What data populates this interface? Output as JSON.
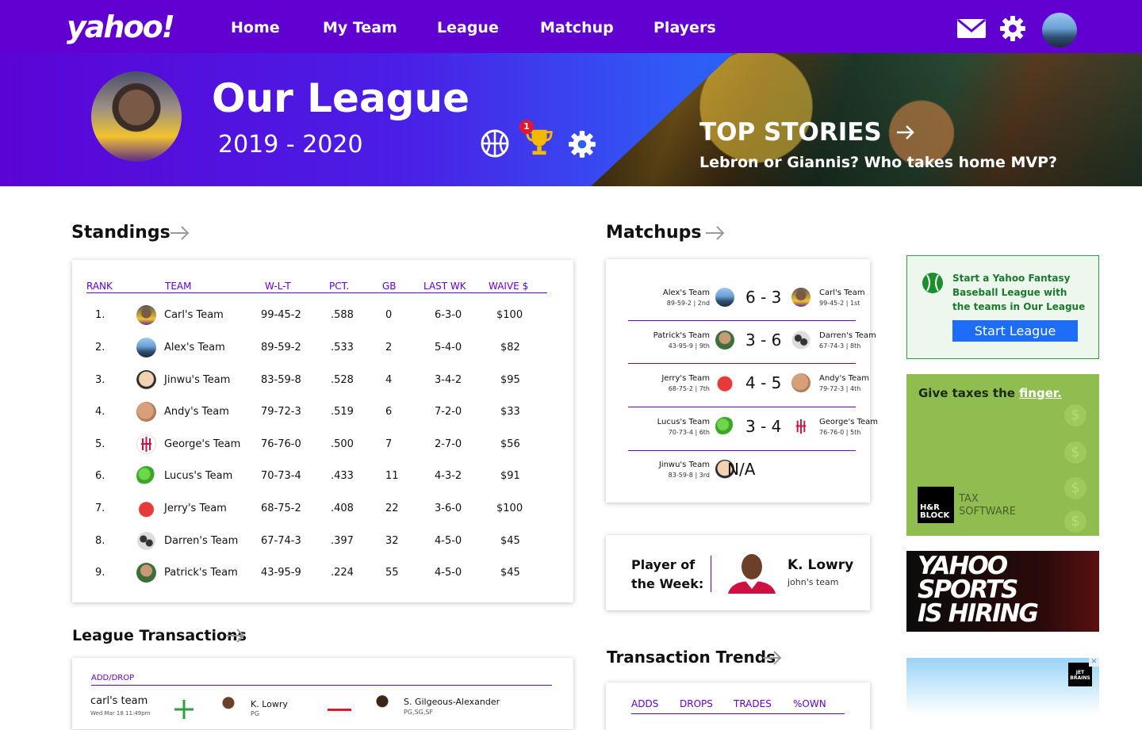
{
  "nav": {
    "logo": "yahoo!",
    "links": [
      "Home",
      "My Team",
      "League",
      "Matchup",
      "Players"
    ],
    "icons": [
      "mail-icon",
      "gear-icon"
    ]
  },
  "hero": {
    "title": "Our League",
    "season": "2019 - 2020",
    "notification_count": "1",
    "stories_title": "TOP STORIES",
    "stories_sub": "Lebron or Giannis? Who takes home MVP?"
  },
  "standings": {
    "title": "Standings",
    "headers": [
      "RANK",
      "TEAM",
      "W-L-T",
      "PCT.",
      "GB",
      "LAST WK",
      "WAIVE $"
    ],
    "rows": [
      {
        "rank": "1.",
        "team": "Carl's Team",
        "wlt": "99-45-2",
        "pct": ".588",
        "gb": "0",
        "last": "6-3-0",
        "waive": "$100"
      },
      {
        "rank": "2.",
        "team": "Alex's Team",
        "wlt": "89-59-2",
        "pct": ".533",
        "gb": "2",
        "last": "5-4-0",
        "waive": "$82"
      },
      {
        "rank": "3.",
        "team": "Jinwu's Team",
        "wlt": "83-59-8",
        "pct": ".528",
        "gb": "4",
        "last": "3-4-2",
        "waive": "$95"
      },
      {
        "rank": "4.",
        "team": "Andy's Team",
        "wlt": "79-72-3",
        "pct": ".519",
        "gb": "6",
        "last": "7-2-0",
        "waive": "$33"
      },
      {
        "rank": "5.",
        "team": "George's Team",
        "wlt": "76-76-0",
        "pct": ".500",
        "gb": "7",
        "last": "2-7-0",
        "waive": "$56"
      },
      {
        "rank": "6.",
        "team": "Lucus's Team",
        "wlt": "70-73-4",
        "pct": ".433",
        "gb": "11",
        "last": "4-3-2",
        "waive": "$91"
      },
      {
        "rank": "7.",
        "team": "Jerry's Team",
        "wlt": "68-75-2",
        "pct": ".408",
        "gb": "22",
        "last": "3-6-0",
        "waive": "$100"
      },
      {
        "rank": "8.",
        "team": "Darren's Team",
        "wlt": "67-74-3",
        "pct": ".397",
        "gb": "32",
        "last": "4-5-0",
        "waive": "$45"
      },
      {
        "rank": "9.",
        "team": "Patrick's Team",
        "wlt": "43-95-9",
        "pct": ".224",
        "gb": "55",
        "last": "4-5-0",
        "waive": "$45"
      }
    ]
  },
  "matchups": {
    "title": "Matchups",
    "rows": [
      {
        "left": "Alex's Team",
        "left_rec": "89-59-2  |  2nd",
        "score": "6 - 3",
        "right": "Carl's Team",
        "right_rec": "99-45-2  |  1st"
      },
      {
        "left": "Patrick's Team",
        "left_rec": "43-95-9  |  9th",
        "score": "3 - 6",
        "right": "Darren's Team",
        "right_rec": "67-74-3  |  8th"
      },
      {
        "left": "Jerry's Team",
        "left_rec": "68-75-2  |  7th",
        "score": "4 - 5",
        "right": "Andy's Team",
        "right_rec": "79-72-3  |  4th"
      },
      {
        "left": "Lucus's Team",
        "left_rec": "70-73-4  |  6th",
        "score": "3 - 4",
        "right": "George's Team",
        "right_rec": "76-76-0  |  5th"
      },
      {
        "left": "Jinwu's Team",
        "left_rec": "83-59-8  |  3rd",
        "score": "N/A",
        "right": "",
        "right_rec": ""
      }
    ]
  },
  "potw": {
    "label_line1": "Player of",
    "label_line2": "the Week:",
    "player": "K. Lowry",
    "team": "john's team"
  },
  "transactions": {
    "title": "League Transactions",
    "header": "ADD/DROP",
    "row": {
      "team": "carl's team",
      "date": "Wed Mar 18 11:49pm",
      "add_player": "K. Lowry",
      "add_pos": "PG",
      "drop_player": "S. Gilgeous-Alexander",
      "drop_pos": "PG,SG,SF"
    }
  },
  "trends": {
    "title": "Transaction Trends",
    "tabs": [
      "ADDS",
      "DROPS",
      "TRADES",
      "%OWN"
    ]
  },
  "ads": {
    "fantasy_text": "Start a Yahoo Fantasy Baseball League with the teams in Our League",
    "fantasy_button": "Start League",
    "hr_headline_pre": "Give taxes the ",
    "hr_headline_em": "finger.",
    "hr_brand": "H&R BLOCK",
    "hr_tax": "TAX",
    "hr_software": "SOFTWARE",
    "ys_line1": "YAHOO",
    "ys_line2": "SPORTS",
    "ys_line3": "IS HIRING",
    "bottom_badge": "JET BRAINS"
  },
  "colors": {
    "brand": "#6001d2",
    "accent_blue": "#1d6df9",
    "green": "#2e9e3e",
    "red": "#e6162d"
  }
}
